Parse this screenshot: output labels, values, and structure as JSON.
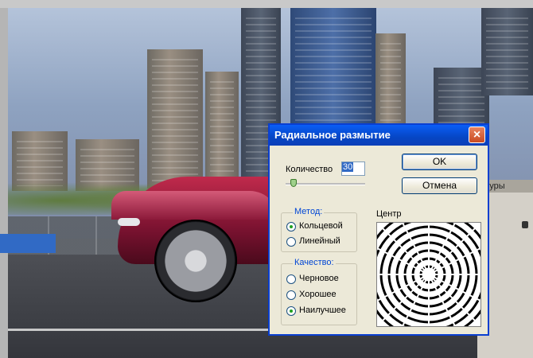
{
  "dialog": {
    "title": "Радиальное размытие",
    "amount_label": "Количество",
    "amount_value": "30",
    "ok_label": "OK",
    "cancel_label": "Отмена",
    "method": {
      "title": "Метод:",
      "options": [
        "Кольцевой",
        "Линейный"
      ],
      "selected": "Кольцевой"
    },
    "quality": {
      "title": "Качество:",
      "options": [
        "Черновое",
        "Хорошее",
        "Наилучшее"
      ],
      "selected": "Наилучшее"
    },
    "center_label": "Центр"
  },
  "panel": {
    "tab_label": "нтуры"
  },
  "colors": {
    "title_bar": "#0a5ef6",
    "dialog_bg": "#ece9d8",
    "car_red": "#b3203f"
  },
  "icons": [
    "close-icon",
    "lock-icon",
    "pin-icon"
  ]
}
